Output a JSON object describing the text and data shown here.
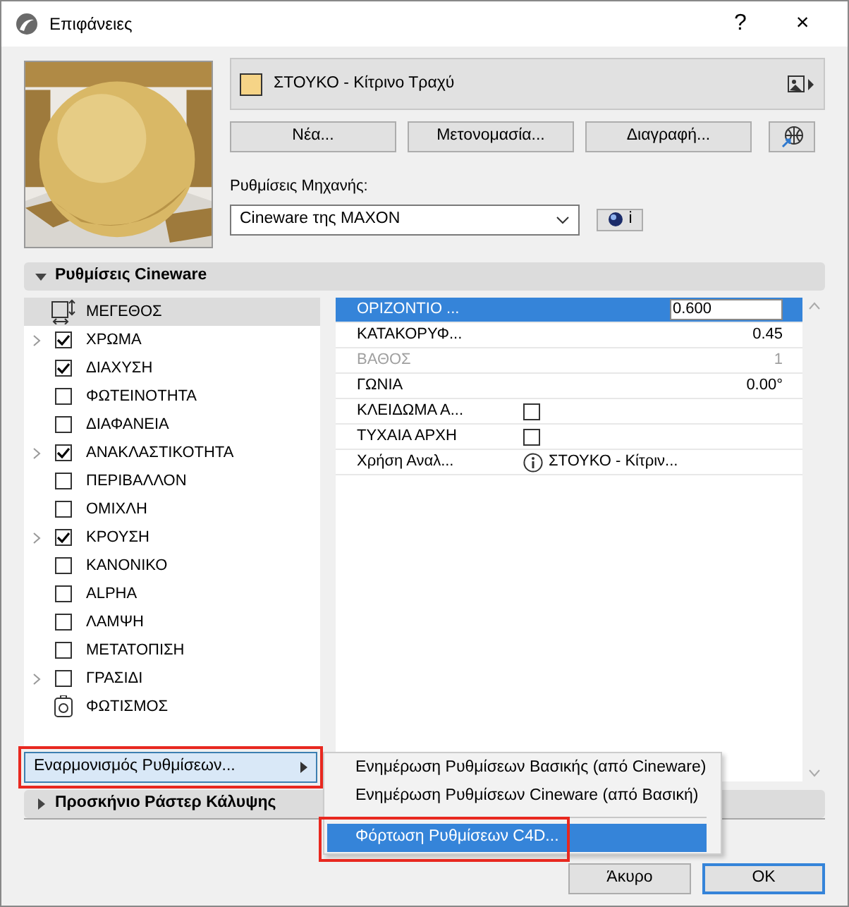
{
  "window": {
    "title": "Επιφάνειες",
    "help": "?",
    "close": "×"
  },
  "material": {
    "name": "ΣΤΟΥΚΟ - Κίτρινο Τραχύ"
  },
  "buttons": [
    "Νέα...",
    "Μετονομασία...",
    "Διαγραφή..."
  ],
  "engine": {
    "label": "Ρυθμίσεις Μηχανής:",
    "value": "Cineware της MAXON",
    "info": "i"
  },
  "sections": [
    {
      "title": "Ρυθμίσεις Cineware",
      "expanded": true
    },
    {
      "title": "Προσκήνιο Ράστερ Κάλυψης",
      "expanded": false
    }
  ],
  "channels": [
    {
      "kind": "size",
      "label": "ΜΕΓΕΘΟΣ",
      "selected": true,
      "expandable": false
    },
    {
      "kind": "check",
      "label": "ΧΡΩΜΑ",
      "checked": true,
      "selected": false,
      "expandable": true
    },
    {
      "kind": "check",
      "label": "ΔΙΑΧΥΣΗ",
      "checked": true,
      "selected": false,
      "expandable": false
    },
    {
      "kind": "check",
      "label": "ΦΩΤΕΙΝΟΤΗΤΑ",
      "checked": false,
      "selected": false,
      "expandable": false
    },
    {
      "kind": "check",
      "label": "ΔΙΑΦΑΝΕΙΑ",
      "checked": false,
      "selected": false,
      "expandable": false
    },
    {
      "kind": "check",
      "label": "ΑΝΑΚΛΑΣΤΙΚΟΤΗΤΑ",
      "checked": true,
      "selected": false,
      "expandable": true
    },
    {
      "kind": "check",
      "label": "ΠΕΡΙΒΑΛΛΟΝ",
      "checked": false,
      "selected": false,
      "expandable": false
    },
    {
      "kind": "check",
      "label": "ΟΜΙΧΛΗ",
      "checked": false,
      "selected": false,
      "expandable": false
    },
    {
      "kind": "check",
      "label": "ΚΡΟΥΣΗ",
      "checked": true,
      "selected": false,
      "expandable": true
    },
    {
      "kind": "check",
      "label": "ΚΑΝΟΝΙΚΟ",
      "checked": false,
      "selected": false,
      "expandable": false
    },
    {
      "kind": "check",
      "label": "ALPHA",
      "checked": false,
      "selected": false,
      "expandable": false
    },
    {
      "kind": "check",
      "label": "ΛΑΜΨΗ",
      "checked": false,
      "selected": false,
      "expandable": false
    },
    {
      "kind": "check",
      "label": "ΜΕΤΑΤΟΠΙΣΗ",
      "checked": false,
      "selected": false,
      "expandable": false
    },
    {
      "kind": "check",
      "label": "ΓΡΑΣΙΔΙ",
      "checked": false,
      "selected": false,
      "expandable": true
    },
    {
      "kind": "light",
      "label": "ΦΩΤΙΣΜΟΣ",
      "selected": false,
      "expandable": false
    }
  ],
  "properties": [
    {
      "kind": "value",
      "label": "ΟΡΙΖΟΝΤΙΟ ...",
      "value": "0.600",
      "selected": true,
      "disabled": false
    },
    {
      "kind": "value",
      "label": "ΚΑΤΑΚΟΡΥΦ...",
      "value": "0.45",
      "selected": false,
      "disabled": false
    },
    {
      "kind": "value",
      "label": "ΒΑΘΟΣ",
      "value": "1",
      "selected": false,
      "disabled": true
    },
    {
      "kind": "value",
      "label": "ΓΩΝΙΑ",
      "value": "0.00°",
      "selected": false,
      "disabled": false
    },
    {
      "kind": "check",
      "label": "ΚΛΕΙΔΩΜΑ Α...",
      "checked": false,
      "selected": false,
      "disabled": false
    },
    {
      "kind": "check",
      "label": "ΤΥΧΑΙΑ ΑΡΧΗ",
      "checked": false,
      "selected": false,
      "disabled": false
    },
    {
      "kind": "info",
      "label": "Χρήση Αναλ...",
      "value": "ΣΤΟΥΚΟ - Κίτριν...",
      "selected": false,
      "disabled": false
    }
  ],
  "sync_button": {
    "label": "Εναρμονισμός Ρυθμίσεων...",
    "highlighted": true
  },
  "menu": [
    {
      "kind": "item",
      "label": "Ενημέρωση Ρυθμίσεων Βασικής (από Cineware)",
      "selected": false,
      "highlighted": false
    },
    {
      "kind": "item",
      "label": "Ενημέρωση Ρυθμίσεων Cineware (από Βασική)",
      "selected": false,
      "highlighted": false
    },
    {
      "kind": "separator"
    },
    {
      "kind": "item",
      "label": "Φόρτωση Ρυθμίσεων C4D...",
      "selected": true,
      "highlighted": true
    }
  ],
  "footer": [
    "Άκυρο",
    "OK"
  ]
}
